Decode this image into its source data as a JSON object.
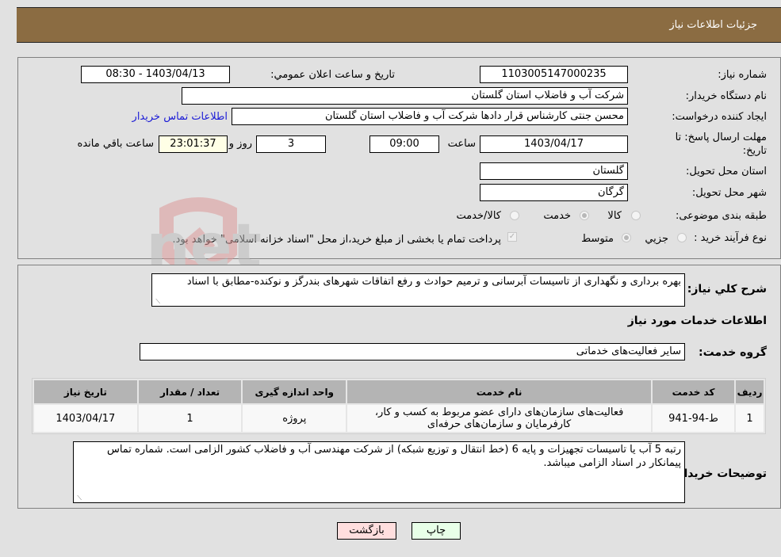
{
  "header": {
    "title": "جزئیات اطلاعات نیاز"
  },
  "info": {
    "need_number_label": "شماره نیاز:",
    "need_number": "1103005147000235",
    "announce_label": "تاریخ و ساعت اعلان عمومي:",
    "announce_value": "1403/04/13 - 08:30",
    "buyer_org_label": "نام دستگاه خریدار:",
    "buyer_org": "شرکت آب و فاضلاب استان گلستان",
    "creator_label": "ایجاد کننده درخواست:",
    "creator": "محسن جنتی کارشناس قرار دادها شرکت آب و فاضلاب استان گلستان",
    "contact_link": "اطلاعات تماس خریدار",
    "deadline_label": "مهلت ارسال پاسخ: تا تاریخ:",
    "deadline_date": "1403/04/17",
    "time_label": "ساعت",
    "deadline_time": "09:00",
    "days_value": "3",
    "days_label": "روز و",
    "remaining_time": "23:01:37",
    "remaining_label": "ساعت باقي مانده",
    "province_label": "استان محل تحویل:",
    "province": "گلستان",
    "city_label": "شهر محل تحویل:",
    "city": "گرگان",
    "category_label": "طبقه بندی موضوعی:",
    "category_options": [
      {
        "label": "کالا",
        "checked": false
      },
      {
        "label": "خدمت",
        "checked": true
      },
      {
        "label": "کالا/خدمت",
        "checked": false
      }
    ],
    "process_label": "نوع فرآیند خرید :",
    "process_options": [
      {
        "label": "جزيي",
        "checked": false
      },
      {
        "label": "متوسط",
        "checked": true
      }
    ],
    "payment_checkbox_checked": true,
    "payment_note": "پرداخت تمام یا بخشی از مبلغ خرید،از محل \"اسناد خزانه اسلامی\" خواهد بود."
  },
  "details": {
    "description_label": "شرح كلي نياز:",
    "description": "بهره برداری و نگهداری از تاسیسات آبرسانی و ترمیم حوادث و رفع اتفاقات شهرهای بندرگز و نوکنده-مطابق با اسناد",
    "services_heading": "اطلاعات خدمات مورد نیاز",
    "service_group_label": "گروه خدمت:",
    "service_group": "سایر فعالیت‌های خدماتی",
    "table": {
      "headers": [
        "ردیف",
        "کد خدمت",
        "نام خدمت",
        "واحد اندازه گیری",
        "تعداد / مقدار",
        "تاریخ نیاز"
      ],
      "rows": [
        [
          "1",
          "ط-94-941",
          "فعالیت‌های سازمان‌های دارای عضو مربوط به کسب و کار، کارفرمایان و سازمان‌های حرفه‌ای",
          "پروژه",
          "1",
          "1403/04/17"
        ]
      ]
    },
    "buyer_notes_label": "توضیحات خریدار:",
    "buyer_notes": "رتبه 5 آب یا تاسیسات تجهیزات و پایه 6 (خط انتقال و توزیع شبکه) از شرکت مهندسی آب و فاضلاب کشور الزامی است. شماره تماس پیمانکار در اسناد الزامی میباشد."
  },
  "buttons": {
    "back": "بازگشت",
    "print": "چاپ"
  },
  "watermark": {
    "text": "AriaTender.net"
  },
  "colors": {
    "header_bg": "#8b6c42",
    "link": "#1a1ad6",
    "back_bg": "#ffdede",
    "print_bg": "#e8ffe8",
    "remaining_bg": "#ffffe6"
  }
}
